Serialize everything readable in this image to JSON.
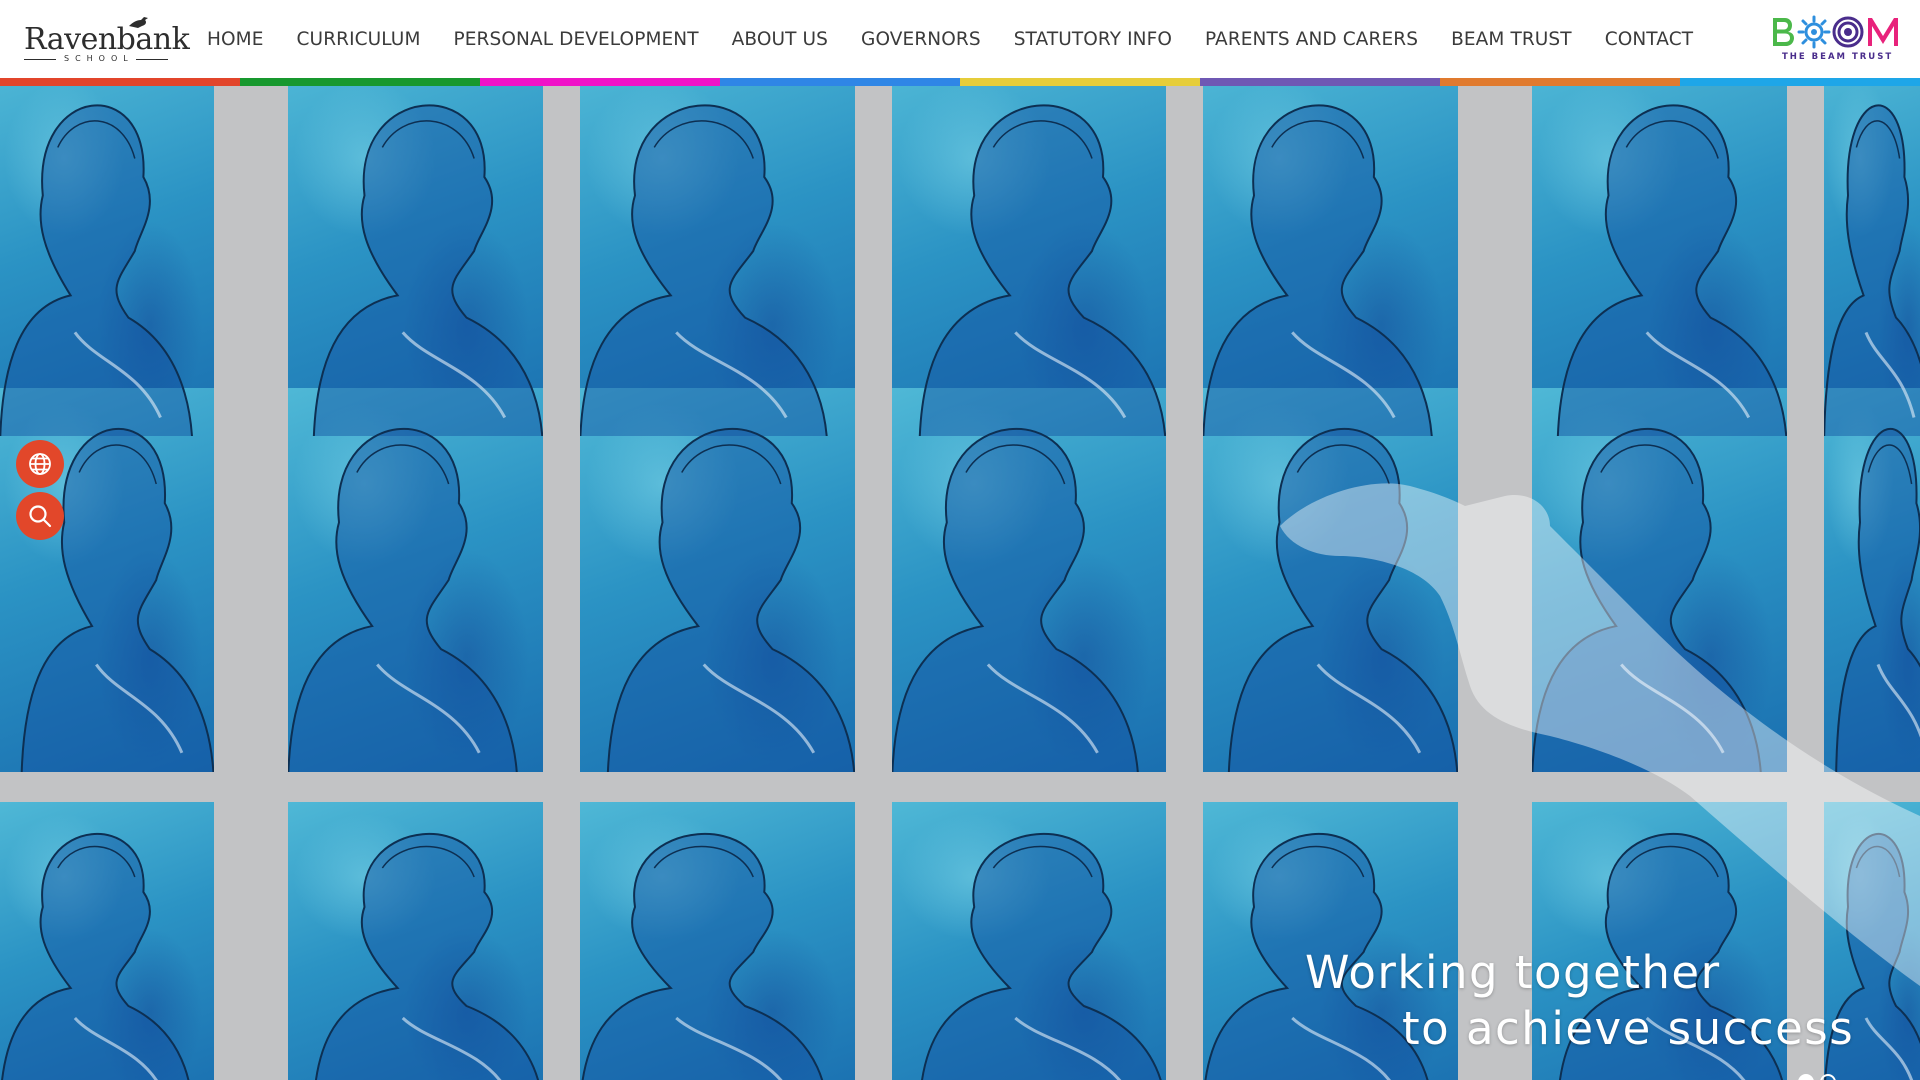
{
  "logo": {
    "name": "Ravenbank",
    "subtitle": "SCHOOL"
  },
  "nav": {
    "items": [
      {
        "label": "HOME"
      },
      {
        "label": "CURRICULUM"
      },
      {
        "label": "PERSONAL DEVELOPMENT"
      },
      {
        "label": "ABOUT US"
      },
      {
        "label": "GOVERNORS"
      },
      {
        "label": "STATUTORY INFO"
      },
      {
        "label": "PARENTS AND CARERS"
      },
      {
        "label": "BEAM TRUST"
      },
      {
        "label": "CONTACT"
      }
    ]
  },
  "trust_logo": {
    "name": "BEAM",
    "subtitle": "THE BEAM TRUST"
  },
  "stripe_colors": [
    "#e2452b",
    "#18982e",
    "#f012c8",
    "#2f86e6",
    "#e6cd3a",
    "#6f58b4",
    "#e07a2e",
    "#1ea6e8"
  ],
  "side_buttons": [
    {
      "icon": "globe-icon",
      "color": "#e2472a"
    },
    {
      "icon": "search-icon",
      "color": "#e2472a"
    }
  ],
  "hero": {
    "line1": "Working together",
    "line2": "to achieve success",
    "slides_total": 2,
    "active_slide": 1
  },
  "accent_color": "#e2472a"
}
